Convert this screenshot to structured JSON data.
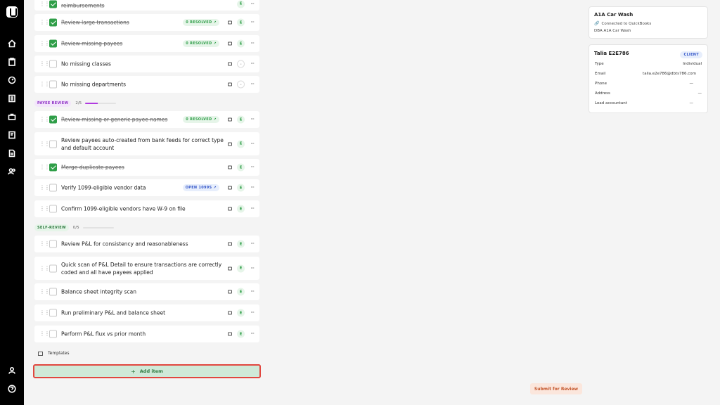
{
  "sidebar": {
    "items": [
      "home",
      "clipboard",
      "gauge",
      "ledger",
      "briefcase",
      "book",
      "document",
      "users"
    ],
    "bottom": [
      "user",
      "help"
    ]
  },
  "sections": [
    {
      "label": "PAYEE REVIEW",
      "count": "2/5",
      "progress": 0.4
    },
    {
      "label": "SELF-REVIEW",
      "count": "0/5",
      "progress": 0
    }
  ],
  "tasks": [
    {
      "title": "reimbursements",
      "checked": true,
      "badge": "",
      "assignee": "E"
    },
    {
      "title": "Review large transactions",
      "checked": true,
      "badge": "0 RESOLVED",
      "assignee": "E"
    },
    {
      "title": "Review missing payees",
      "checked": true,
      "badge": "0 RESOLVED",
      "assignee": "E"
    },
    {
      "title": "No missing classes",
      "checked": false,
      "badge": "",
      "assignee": "-"
    },
    {
      "title": "No missing departments",
      "checked": false,
      "badge": "",
      "assignee": "-"
    },
    {
      "title": "Review missing or generic payee names",
      "checked": true,
      "badge": "0 RESOLVED",
      "assignee": "E"
    },
    {
      "title": "Review payees auto-created from bank feeds for correct type and default account",
      "checked": false,
      "badge": "",
      "assignee": "E"
    },
    {
      "title": "Merge duplicate payees",
      "checked": true,
      "badge": "",
      "assignee": "E"
    },
    {
      "title": "Verify 1099-eligible vendor data",
      "checked": false,
      "badge": "OPEN 1099S",
      "assignee": "E"
    },
    {
      "title": "Confirm 1099-eligible vendors have W-9 on file",
      "checked": false,
      "badge": "",
      "assignee": "E"
    },
    {
      "title": "Review P&L for consistency and reasonableness",
      "checked": false,
      "badge": "",
      "assignee": "E"
    },
    {
      "title": "Quick scan of P&L Detail to ensure transactions are correctly coded and all have payees applied",
      "checked": false,
      "badge": "",
      "assignee": "E"
    },
    {
      "title": "Balance sheet integrity scan",
      "checked": false,
      "badge": "",
      "assignee": "E"
    },
    {
      "title": "Run preliminary P&L and balance sheet",
      "checked": false,
      "badge": "",
      "assignee": "E"
    },
    {
      "title": "Perform P&L flux vs prior month",
      "checked": false,
      "badge": "",
      "assignee": "E"
    }
  ],
  "templates_label": "Templates",
  "add_item_label": "Add item",
  "submit_label": "Submit for Review",
  "company": {
    "name": "A1A Car Wash",
    "connection": "Connected to QuickBooks",
    "dba": "DBA A1A Car Wash"
  },
  "client": {
    "name": "Talia E2E786",
    "badge": "CLIENT",
    "fields": [
      {
        "label": "Type",
        "value": "Individual"
      },
      {
        "label": "Email",
        "value": "talia.e2e786@dbts786.com"
      },
      {
        "label": "Phone",
        "value": "—"
      },
      {
        "label": "Address",
        "value": "—"
      },
      {
        "label": "Lead accountant",
        "value": "—"
      }
    ]
  },
  "colors": {
    "accent_green": "#2f9e48",
    "payee_purple": "#b13be0",
    "highlight_red": "#e1473f"
  }
}
